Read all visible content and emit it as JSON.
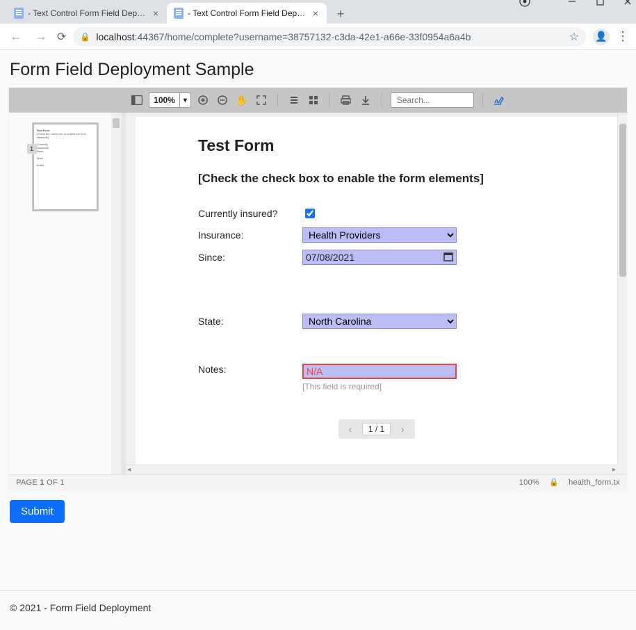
{
  "browser": {
    "tabs": [
      {
        "title": " - Text Control Form Field Deploy",
        "active": false
      },
      {
        "title": " - Text Control Form Field Deploy",
        "active": true
      }
    ],
    "url_host": "localhost",
    "url_rest": ":44367/home/complete?username=38757132-c3da-42e1-a66e-33f0954a6a4b"
  },
  "page": {
    "header": "Form Field Deployment Sample",
    "submit_label": "Submit",
    "footer": "© 2021 - Form Field Deployment"
  },
  "toolbar": {
    "zoom": "100%",
    "search_placeholder": "Search..."
  },
  "statusbar": {
    "page_label_prefix": "PAGE ",
    "page_current": "1",
    "page_mid": " OF ",
    "page_total": "1",
    "zoom": "100%",
    "filename": "health_form.tx"
  },
  "thumbnail": {
    "page_number": "1"
  },
  "doc": {
    "title": "Test Form",
    "instruction": "[Check the check box to enable the form elements]",
    "labels": {
      "insured": "Currently insured?",
      "insurance": "Insurance:",
      "since": "Since:",
      "state": "State:",
      "notes": "Notes:"
    },
    "values": {
      "insured_checked": true,
      "insurance": "Health Providers",
      "since": "07/08/2021",
      "state": "North Carolina",
      "notes": "N/A"
    },
    "required_note": "[This field is required]",
    "pager": "1 / 1"
  }
}
